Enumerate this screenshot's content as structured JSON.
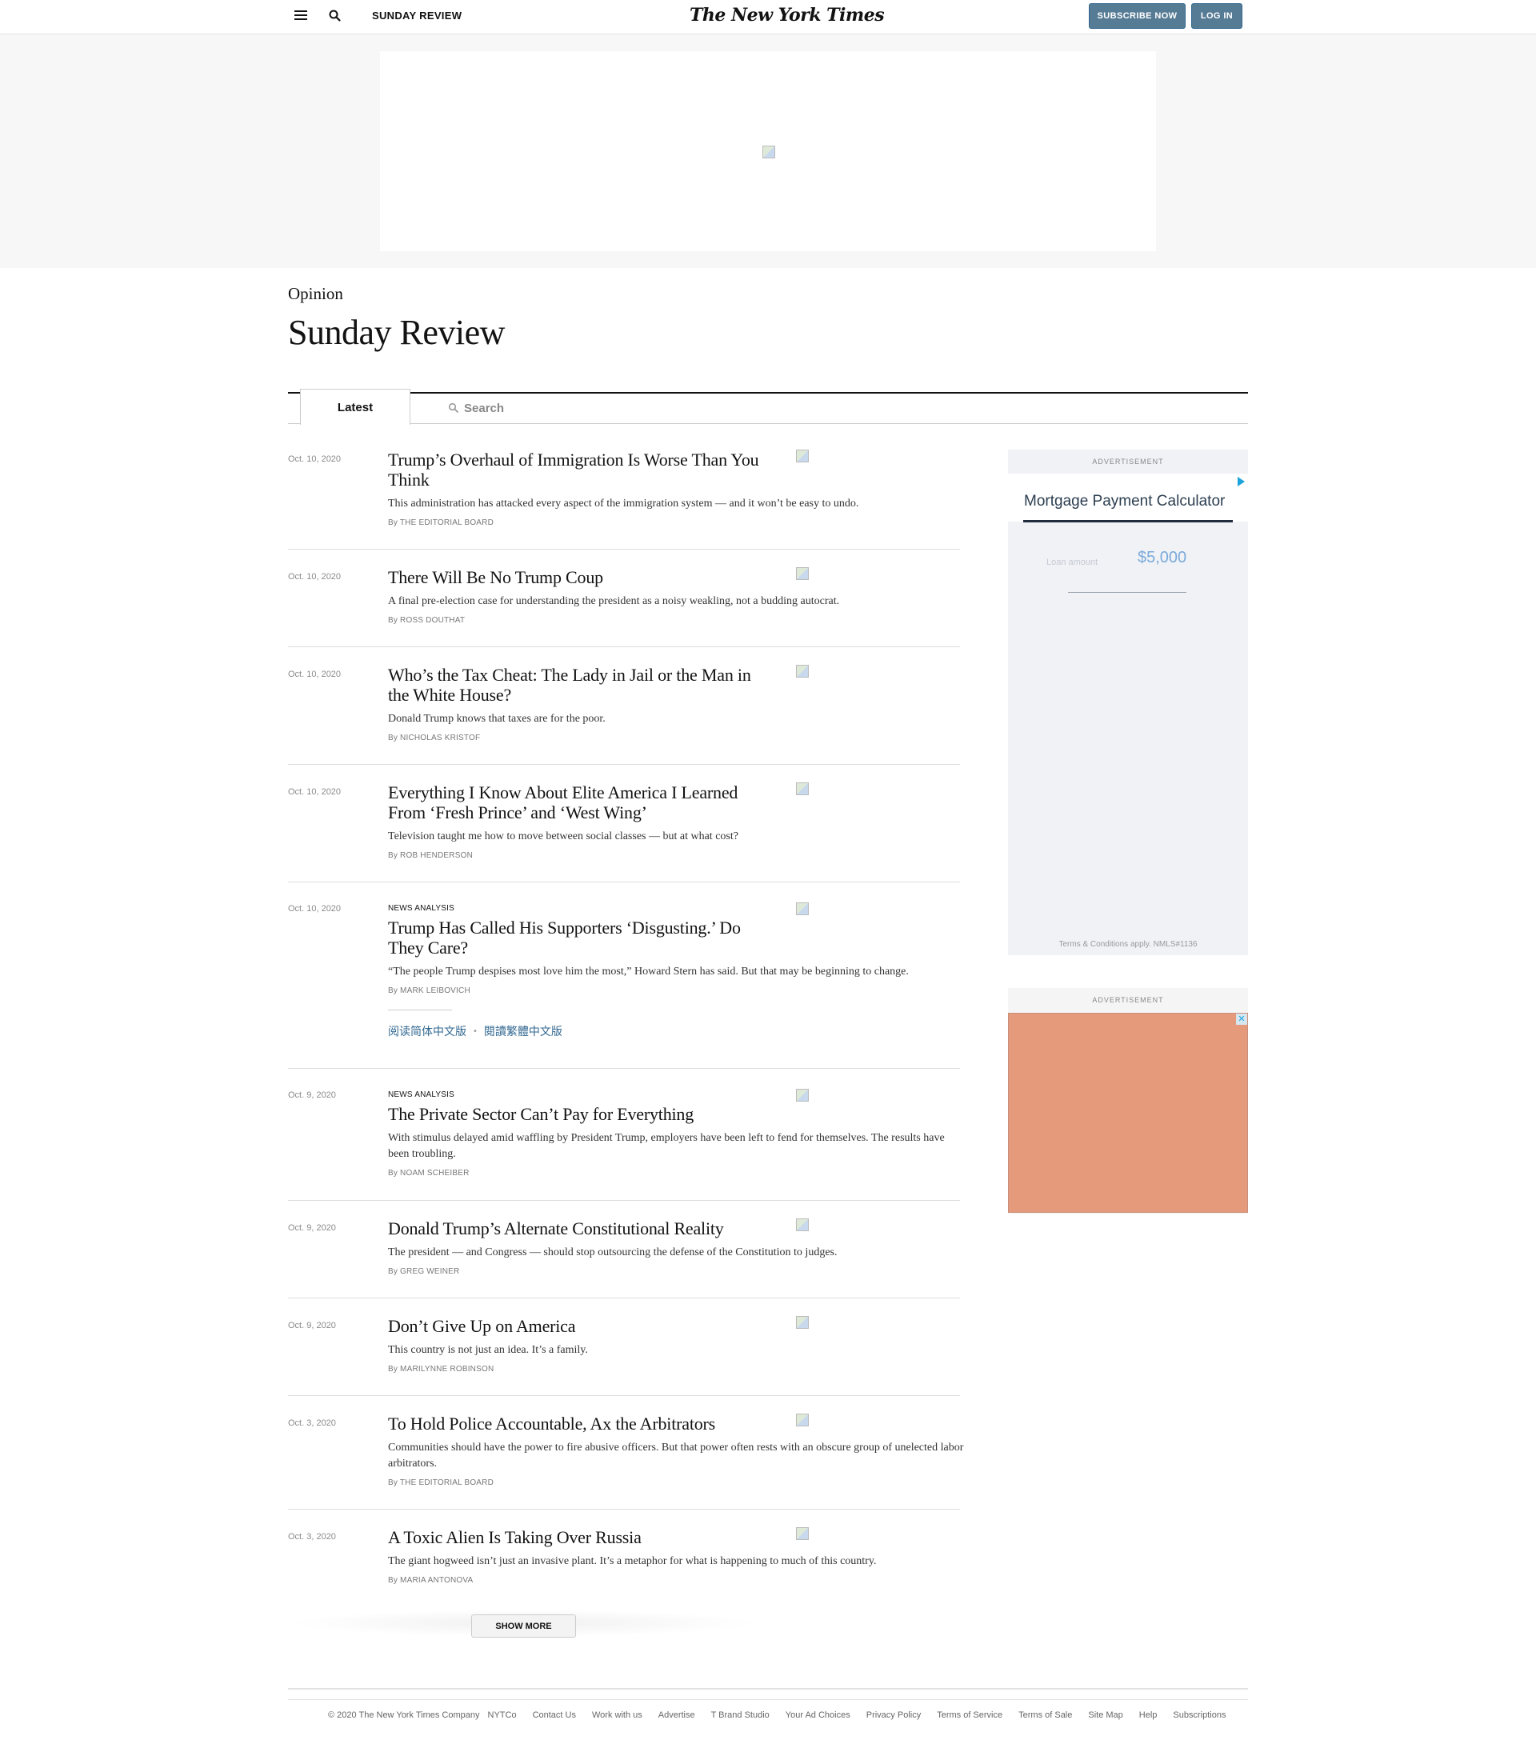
{
  "header": {
    "section_name": "SUNDAY REVIEW",
    "logo": "The New York Times",
    "subscribe_label": "SUBSCRIBE NOW",
    "login_label": "LOG IN",
    "brand_button_color": "#567b95"
  },
  "page": {
    "kicker": "Opinion",
    "title": "Sunday Review"
  },
  "tabs": {
    "latest": "Latest",
    "search_placeholder": "Search"
  },
  "articles": [
    {
      "date": "Oct. 10, 2020",
      "label": "",
      "headline": "Trump’s Overhaul of Immigration Is Worse Than You Think",
      "summary": "This administration has attacked every aspect of the immigration system — and it won’t be easy to undo.",
      "byline": "By THE EDITORIAL BOARD"
    },
    {
      "date": "Oct. 10, 2020",
      "label": "",
      "headline": "There Will Be No Trump Coup",
      "summary": "A final pre-election case for understanding the president as a noisy weakling, not a budding autocrat.",
      "byline": "By ROSS DOUTHAT"
    },
    {
      "date": "Oct. 10, 2020",
      "label": "",
      "headline": "Who’s the Tax Cheat: The Lady in Jail or the Man in the White House?",
      "summary": "Donald Trump knows that taxes are for the poor.",
      "byline": "By NICHOLAS KRISTOF"
    },
    {
      "date": "Oct. 10, 2020",
      "label": "",
      "headline": "Everything I Know About Elite America I Learned From ‘Fresh Prince’ and ‘West Wing’",
      "summary": "Television taught me how to move between social classes — but at what cost?",
      "byline": "By ROB HENDERSON"
    },
    {
      "date": "Oct. 10, 2020",
      "label": "NEWS ANALYSIS",
      "headline": "Trump Has Called His Supporters ‘Disgusting.’ Do They Care?",
      "summary": "“The people Trump despises most love him the most,” Howard Stern has said. But that may be beginning to change.",
      "byline": "By MARK LEIBOVICH",
      "lang_simplified": "阅读简体中文版",
      "lang_traditional": "閱讀繁體中文版",
      "lang_sep": "•"
    },
    {
      "date": "Oct. 9, 2020",
      "label": "NEWS ANALYSIS",
      "headline": "The Private Sector Can’t Pay for Everything",
      "summary": "With stimulus delayed amid waffling by President Trump, employers have been left to fend for themselves. The results have been troubling.",
      "byline": "By NOAM SCHEIBER"
    },
    {
      "date": "Oct. 9, 2020",
      "label": "",
      "headline": "Donald Trump’s Alternate Constitutional Reality",
      "summary": "The president — and Congress — should stop outsourcing the defense of the Constitution to judges.",
      "byline": "By GREG WEINER"
    },
    {
      "date": "Oct. 9, 2020",
      "label": "",
      "headline": "Don’t Give Up on America",
      "summary": "This country is not just an idea. It’s a family.",
      "byline": "By MARILYNNE ROBINSON"
    },
    {
      "date": "Oct. 3, 2020",
      "label": "",
      "headline": "To Hold Police Accountable, Ax the Arbitrators",
      "summary": "Communities should have the power to fire abusive officers. But that power often rests with an obscure group of unelected labor arbitrators.",
      "byline": "By THE EDITORIAL BOARD"
    },
    {
      "date": "Oct. 3, 2020",
      "label": "",
      "headline": "A Toxic Alien Is Taking Over Russia",
      "summary": "The giant hogweed isn’t just an invasive plant. It’s a metaphor for what is happening to much of this country.",
      "byline": "By MARIA ANTONOVA"
    }
  ],
  "show_more": "SHOW MORE",
  "sidebar": {
    "ad_label": "ADVERTISEMENT",
    "calculator_title": "Mortgage Payment Calculator",
    "loan_label": "Loan amount",
    "loan_value": "$5,000",
    "terms": "Terms & Conditions apply. NMLS#1136",
    "ad2_label": "ADVERTISEMENT",
    "ad2_color": "#e69a7c",
    "close_glyph": "✕"
  },
  "footer": {
    "copyright": "© 2020 The New York Times Company",
    "links": [
      "NYTCo",
      "Contact Us",
      "Work with us",
      "Advertise",
      "T Brand Studio",
      "Your Ad Choices",
      "Privacy Policy",
      "Terms of Service",
      "Terms of Sale",
      "Site Map",
      "Help",
      "Subscriptions"
    ]
  }
}
